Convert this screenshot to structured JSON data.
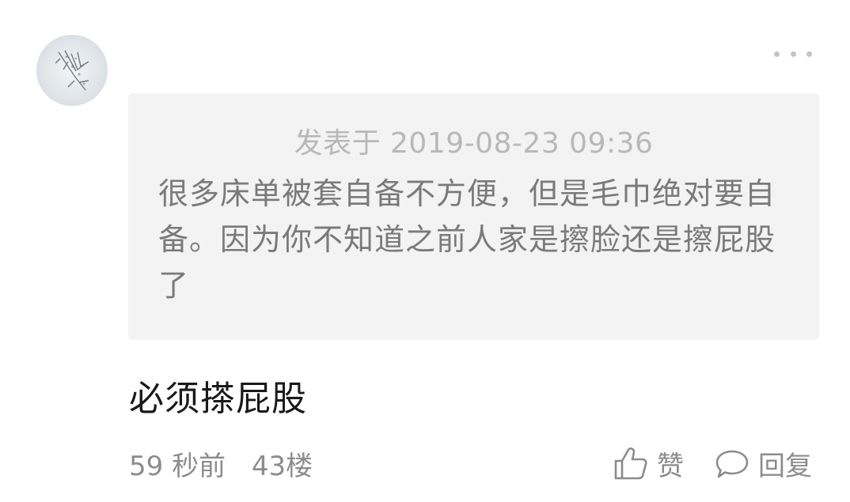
{
  "comment": {
    "quote": {
      "posted_at": "发表于 2019-08-23 09:36",
      "text": "很多床单被套自备不方便，但是毛巾绝对要自备。因为你不知道之前人家是擦脸还是擦屁股了"
    },
    "reply_text": "必须搽屁股",
    "time_ago": "59 秒前",
    "floor": "43楼",
    "like_label": "赞",
    "reply_label": "回复"
  },
  "icons": {
    "more": "more-icon",
    "like": "thumbs-up-icon",
    "reply": "speech-bubble-icon"
  }
}
